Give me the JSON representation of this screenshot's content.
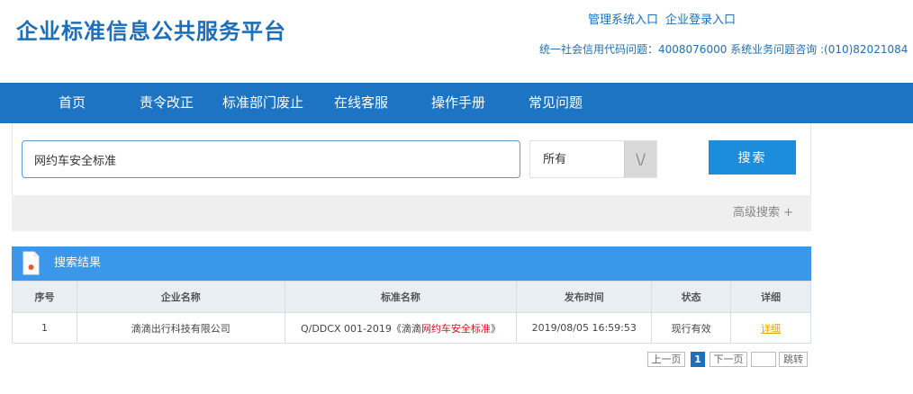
{
  "header": {
    "site_title": "企业标准信息公共服务平台",
    "links": [
      "管理系统入口",
      "企业登录入口"
    ],
    "hotline": "统一社会信用代码问题：4008076000 系统业务问题咨询 :(010)82021084"
  },
  "nav": {
    "items": [
      "首页",
      "责令改正",
      "标准部门废止",
      "在线客服",
      "操作手册",
      "常见问题"
    ]
  },
  "search": {
    "query": "网约车安全标准",
    "scope": "所有",
    "scope_arrow": "\\/",
    "button_label": "搜索",
    "advanced_label": "高级搜索 +"
  },
  "results": {
    "title": "搜索结果",
    "columns": [
      "序号",
      "企业名称",
      "标准名称",
      "发布时间",
      "状态",
      "详细"
    ],
    "rows": [
      {
        "index": "1",
        "company": "滴滴出行科技有限公司",
        "standard_prefix": "Q/DDCX 001-2019《滴滴",
        "standard_highlight": "网约车安全标准",
        "standard_suffix": "》",
        "published": "2019/08/05 16:59:53",
        "status": "现行有效",
        "detail": "详细"
      }
    ]
  },
  "pagination": {
    "prev": "上一页",
    "current": "1",
    "next": "下一页",
    "jump_value": "",
    "go": "跳转"
  },
  "colors": {
    "brand": "#1c6fb8",
    "nav_bg": "#1c74c3",
    "results_header_bg": "#3a97ea",
    "highlight": "#d3141c",
    "detail_link": "#e8a200"
  }
}
